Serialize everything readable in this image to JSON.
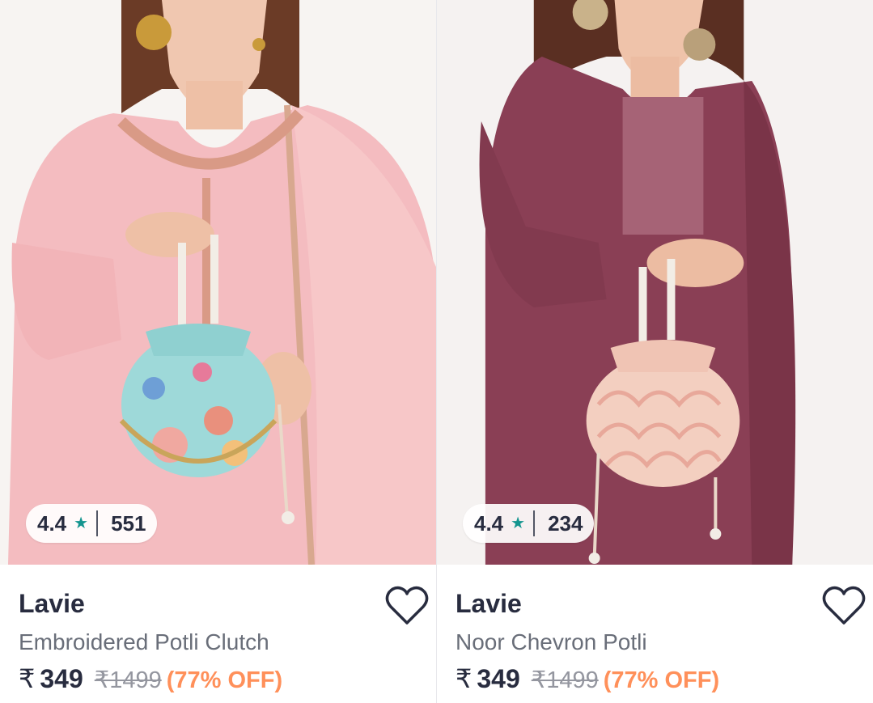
{
  "products": [
    {
      "image_alt": "Embroidered potli clutch",
      "rating": "4.4",
      "rating_icon": "star-icon",
      "review_count": "551",
      "brand": "Lavie",
      "name": "Embroidered Potli Clutch",
      "currency": "₹",
      "price": "349",
      "mrp": "₹1499",
      "discount": "(77% OFF)",
      "colors": {
        "outfit": "#f4bcc0",
        "bag": "#9ed9d9"
      }
    },
    {
      "image_alt": "Noor chevron potli",
      "rating": "4.4",
      "rating_icon": "star-icon",
      "review_count": "234",
      "brand": "Lavie",
      "name": "Noor Chevron Potli",
      "currency": "₹",
      "price": "349",
      "mrp": "₹1499",
      "discount": "(77% OFF)",
      "colors": {
        "outfit": "#8a3f55",
        "bag": "#f3cfc0"
      }
    }
  ],
  "theme": {
    "star_color": "#14958f",
    "discount_color": "#ff905a",
    "text_primary": "#282c3f",
    "text_secondary": "#696e79"
  }
}
